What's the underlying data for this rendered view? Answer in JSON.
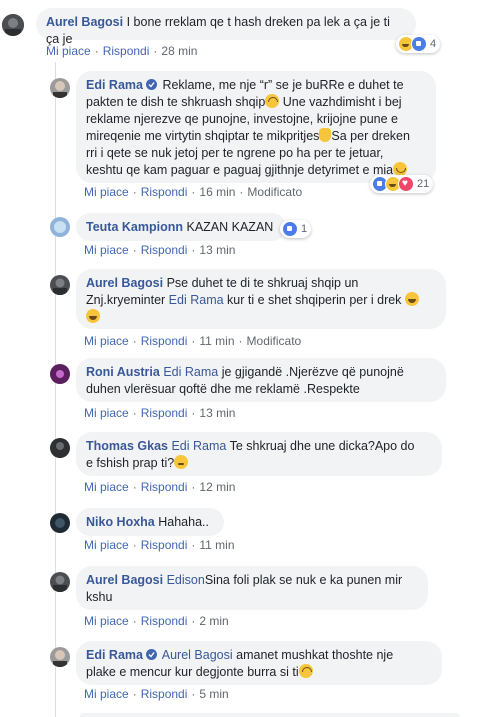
{
  "labels": {
    "like": "Mi piace",
    "reply": "Rispondi",
    "modified": "Modificato",
    "dot": "·"
  },
  "comments": [
    {
      "author": "Aurel Bagosi",
      "text": "I bone rreklam qe t hash dreken pa lek a ça je ti ça je",
      "time": "28 min",
      "reactions": "4",
      "verified": false
    },
    {
      "author": "Edi Rama",
      "verified": true,
      "text_lines": [
        "Reklame, me nje “r” se je buRRe e duhet te",
        "pakten te dish te shkruash shqip",
        "Une vazhdimisht i bej",
        "reklame njerezve qe punojne, investojne, krijojne pune e",
        "mireqenie me virtytin shqiptar te mikpritjes",
        "Sa per dreken",
        "rri i qete se nuk jetoj per te ngrene po ha per te jetuar,",
        "keshtu qe kam paguar e paguaj gjithnje detyrimet e mia"
      ],
      "time": "16 min",
      "modified": true,
      "reactions": "21"
    },
    {
      "author": "Teuta Kampionn",
      "text": "KAZAN KAZAN",
      "time": "13 min",
      "reactions": "1"
    },
    {
      "author": "Aurel Bagosi",
      "text_a": "Pse duhet te di te shkruaj shqip un",
      "text_b": "Znj.kryeminter",
      "tag": "Edi Rama",
      "text_c": "kur ti e shet shqiperin per i drek",
      "time": "11 min",
      "modified": true
    },
    {
      "author": "Roni Austria",
      "tag": "Edi Rama",
      "text_a": "je gjigandë .Njerëzve që punojnë",
      "text_b": "duhen vlerësuar qoftë dhe me reklamë .Respekte",
      "time": "13 min"
    },
    {
      "author": "Thomas Gkas",
      "tag": "Edi Rama",
      "text_a": "Te shkruaj dhe une dicka?Apo do",
      "text_b": "e fshish prap ti?",
      "time": "12 min"
    },
    {
      "author": "Niko Hoxha",
      "text": "Hahaha..",
      "time": "11 min"
    },
    {
      "author": "Aurel Bagosi",
      "tag": "Edison",
      "text_a": "Sina foli plak se nuk e ka punen mir",
      "text_b": "kshu",
      "time": "2 min"
    },
    {
      "author": "Edi Rama",
      "verified": true,
      "tag": "Aurel Bagosi",
      "text_a": "amanet mushkat thoshte nje",
      "text_b": "plake e mencur kur degjonte burra si ti",
      "time": "5 min"
    }
  ]
}
